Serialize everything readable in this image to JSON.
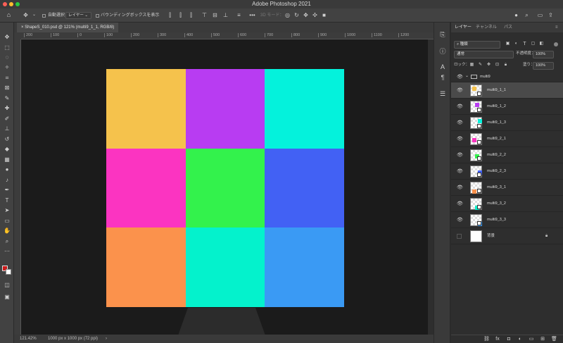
{
  "window": {
    "title": "Adobe Photoshop 2021"
  },
  "options_bar": {
    "auto_select_label": "自動選択：",
    "auto_select_value": "レイヤー",
    "show_bounding_box_label": "バウンディングボックスを表示",
    "mode3d_label": "3D モード："
  },
  "document_tab": {
    "label": "ShapeS_010.psd @ 121% (multi9_1_1, RGB/8)"
  },
  "ruler": {
    "labels": [
      "200",
      "100",
      "0",
      "100",
      "200",
      "300",
      "400",
      "500",
      "600",
      "700",
      "800",
      "900",
      "1000",
      "1100",
      "1200"
    ]
  },
  "canvas": {
    "grid_colors": [
      [
        "#f5c24c",
        "#b83cf2",
        "#04f2dc"
      ],
      [
        "#fb34c1",
        "#33f24c",
        "#4261f4"
      ],
      [
        "#fb924c",
        "#04f2cc",
        "#3a9af4"
      ]
    ]
  },
  "status": {
    "zoom": "121.42%",
    "doc_info": "1000 px x 1000 px (72 ppi)"
  },
  "layers_panel": {
    "tabs": [
      "レイヤー",
      "チャンネル",
      "パス"
    ],
    "filter_label": "種類",
    "blend_mode": "通常",
    "opacity_label": "不透明度：",
    "opacity_value": "100%",
    "lock_label": "ロック：",
    "fill_label": "塗り：",
    "fill_value": "100%",
    "group_name": "multi9",
    "layers": [
      {
        "name": "multi9_1_1",
        "color": "#f5c24c"
      },
      {
        "name": "multi9_1_2",
        "color": "#b83cf2"
      },
      {
        "name": "multi9_1_3",
        "color": "#04f2dc"
      },
      {
        "name": "multi9_2_1",
        "color": "#fb34c1"
      },
      {
        "name": "multi9_2_2",
        "color": "#33f24c"
      },
      {
        "name": "multi9_2_3",
        "color": "#4261f4"
      },
      {
        "name": "multi9_3_1",
        "color": "#fb924c"
      },
      {
        "name": "multi9_3_2",
        "color": "#04f2cc"
      },
      {
        "name": "multi9_3_3",
        "color": "#3a9af4"
      }
    ],
    "background_layer": {
      "name": "背景"
    }
  },
  "colors": {
    "foreground": "#cc1a1a",
    "background": "#ffffff",
    "selected_layer": "#4a4a4a"
  }
}
